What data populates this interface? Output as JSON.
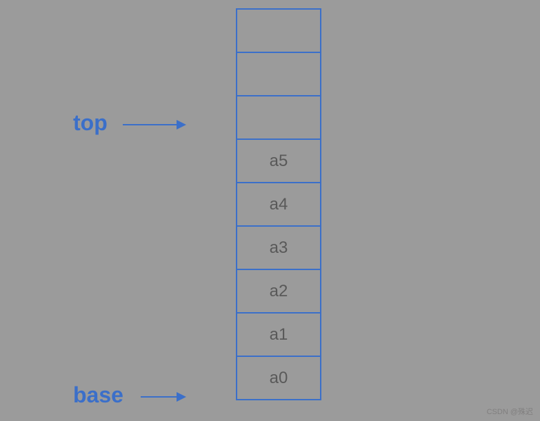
{
  "chart_data": {
    "type": "diagram",
    "structure": "stack",
    "cells_top_to_bottom": [
      "",
      "",
      "",
      "a5",
      "a4",
      "a3",
      "a2",
      "a1",
      "a0"
    ],
    "pointers": [
      {
        "name": "top",
        "points_to_index_from_top": 2
      },
      {
        "name": "base",
        "points_to_index_from_top": 8
      }
    ]
  },
  "labels": {
    "top": "top",
    "base": "base"
  },
  "cells": {
    "c0": "",
    "c1": "",
    "c2": "",
    "c3": "a5",
    "c4": "a4",
    "c5": "a3",
    "c6": "a2",
    "c7": "a1",
    "c8": "a0"
  },
  "watermark": "CSDN @殊迟"
}
